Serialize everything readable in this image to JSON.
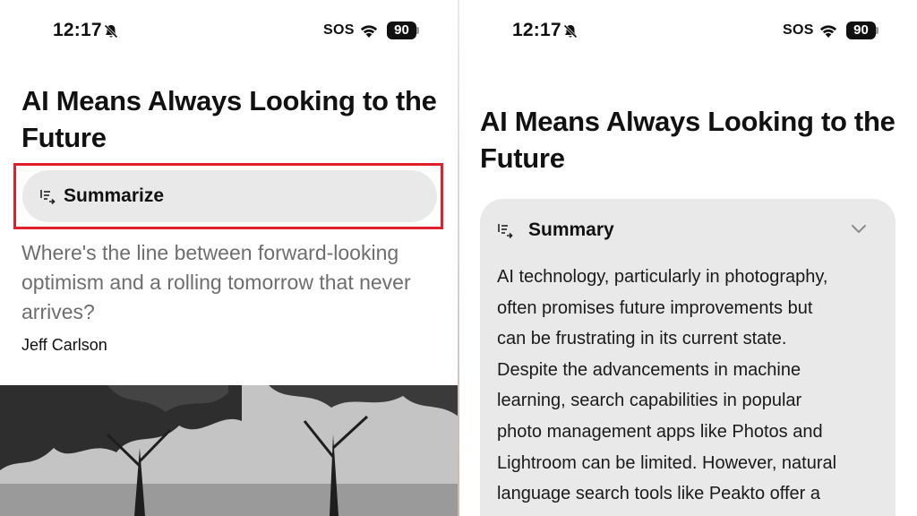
{
  "left_screen": {
    "status": {
      "time": "12:17",
      "carrier": "SOS",
      "battery": "90"
    },
    "article": {
      "title": "AI Means Always Looking to the Future",
      "summarize_label": "Summarize",
      "dek": "Where's the line between forward-looking optimism and a rolling tomorrow that never arrives?",
      "author": "Jeff Carlson"
    }
  },
  "right_screen": {
    "status": {
      "time": "12:17",
      "carrier": "SOS",
      "battery": "90"
    },
    "article": {
      "title": "AI Means Always Looking to the Future",
      "summary_heading": "Summary",
      "summary_lines": [
        "AI technology, particularly in photography,",
        "often promises future improvements but",
        "can be frustrating in its current state.",
        "Despite the advancements in machine",
        "learning, search capabilities in popular",
        "photo management apps like Photos and",
        "Lightroom can be limited. However, natural",
        "language search tools like Peakto offer a"
      ]
    }
  },
  "colors": {
    "highlight_border": "#e0202a",
    "pill_background": "#e9e9ea",
    "dek_text": "#6e6e70"
  },
  "icons": [
    "bell-slash-icon",
    "wifi-icon",
    "battery-icon",
    "summary-lines-icon",
    "chevron-down-icon"
  ]
}
